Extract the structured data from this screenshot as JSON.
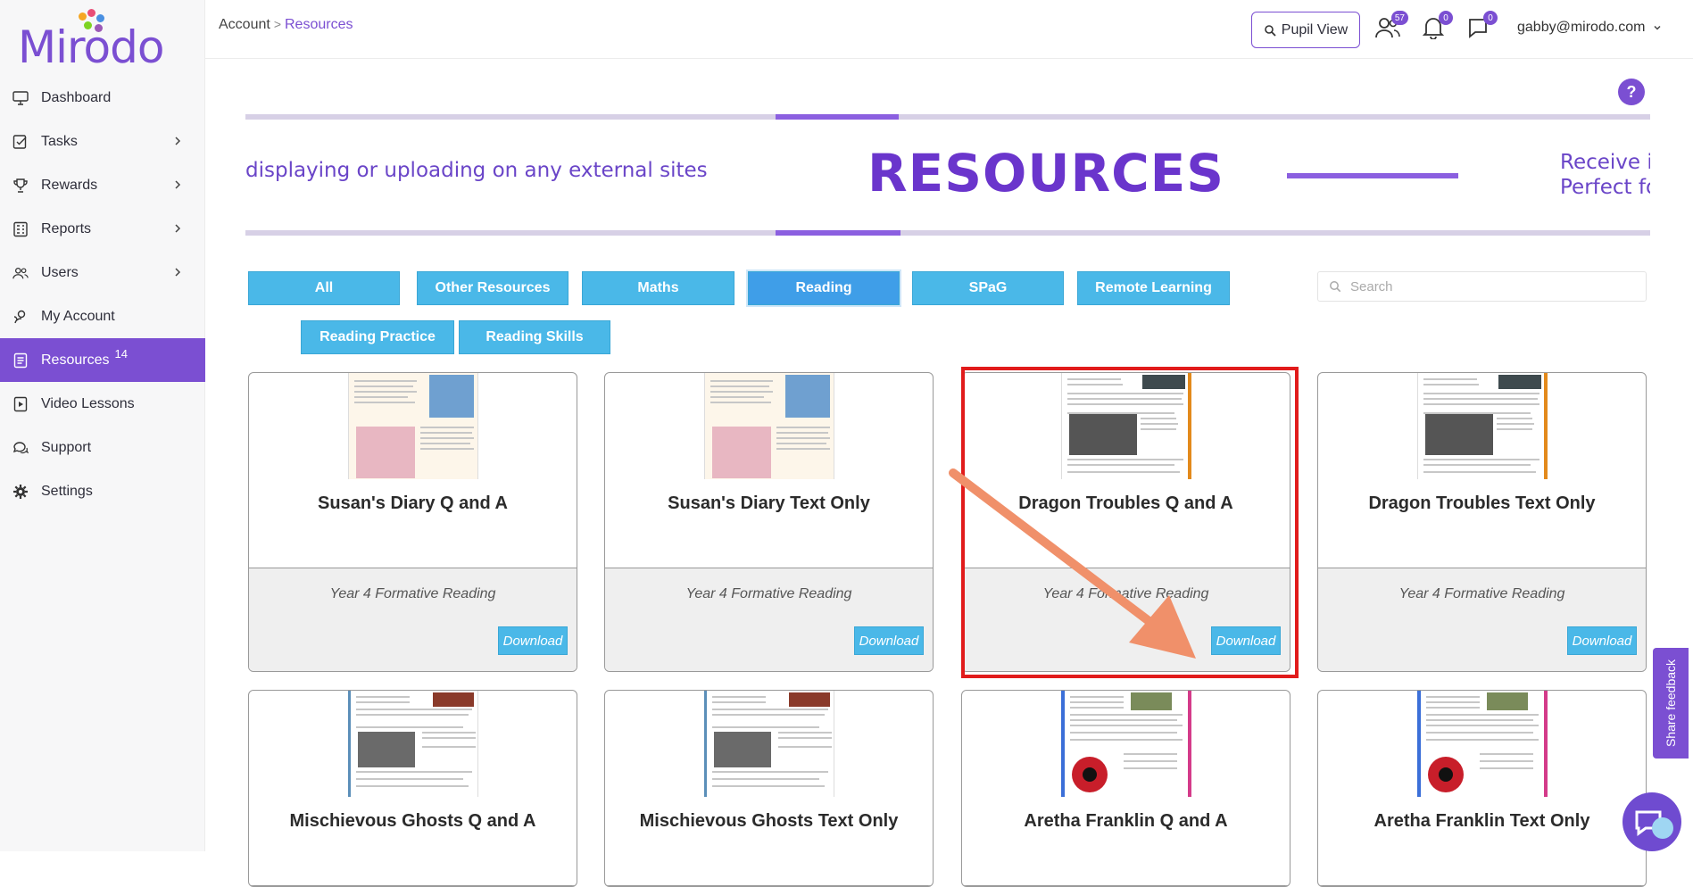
{
  "app": {
    "logo_text": "Mirodo",
    "brand_color": "#7b4fd2"
  },
  "sidebar": {
    "items": [
      {
        "label": "Dashboard",
        "icon": "monitor-icon",
        "has_chevron": false
      },
      {
        "label": "Tasks",
        "icon": "tasks-icon",
        "has_chevron": true
      },
      {
        "label": "Rewards",
        "icon": "trophy-icon",
        "has_chevron": true
      },
      {
        "label": "Reports",
        "icon": "reports-icon",
        "has_chevron": true
      },
      {
        "label": "Users",
        "icon": "users-icon",
        "has_chevron": true
      },
      {
        "label": "My Account",
        "icon": "account-icon",
        "has_chevron": false
      },
      {
        "label": "Resources",
        "icon": "resources-icon",
        "has_chevron": false,
        "badge": "14",
        "active": true
      },
      {
        "label": "Video Lessons",
        "icon": "video-icon",
        "has_chevron": false
      },
      {
        "label": "Support",
        "icon": "support-icon",
        "has_chevron": false
      },
      {
        "label": "Settings",
        "icon": "gear-icon",
        "has_chevron": false
      }
    ]
  },
  "header": {
    "breadcrumb": {
      "parent": "Account",
      "separator": ">",
      "current": "Resources"
    },
    "pupil_view_label": "Pupil View",
    "users_count": "57",
    "notifications_count": "0",
    "messages_count": "0",
    "user_email": "gabby@mirodo.com"
  },
  "help_label": "?",
  "banner": {
    "left_text": "displaying or uploading on any external sites",
    "title": "RESOURCES",
    "right_line1": "Receive ir",
    "right_line2": "Perfect fo"
  },
  "filters": {
    "row1": [
      "All",
      "Other Resources",
      "Maths",
      "Reading",
      "SPaG",
      "Remote Learning"
    ],
    "row2": [
      "Reading Practice",
      "Reading Skills"
    ],
    "active": "Reading",
    "search_placeholder": "Search"
  },
  "cards": [
    {
      "title": "Susan's Diary Q and A",
      "subtitle": "Year 4 Formative Reading",
      "button": "Download"
    },
    {
      "title": "Susan's Diary Text Only",
      "subtitle": "Year 4 Formative Reading",
      "button": "Download"
    },
    {
      "title": "Dragon Troubles Q and A",
      "subtitle": "Year 4 Formative Reading",
      "button": "Download"
    },
    {
      "title": "Dragon Troubles Text Only",
      "subtitle": "Year 4 Formative Reading",
      "button": "Download"
    },
    {
      "title": "Mischievous Ghosts Q and A"
    },
    {
      "title": "Mischievous Ghosts Text Only"
    },
    {
      "title": "Aretha Franklin Q and A"
    },
    {
      "title": "Aretha Franklin Text Only"
    }
  ],
  "feedback_label": "Share feedback",
  "colors": {
    "filter_blue": "#4ab8e8",
    "highlight_red": "#e11b1b",
    "annotation_arrow": "#f0906a"
  }
}
